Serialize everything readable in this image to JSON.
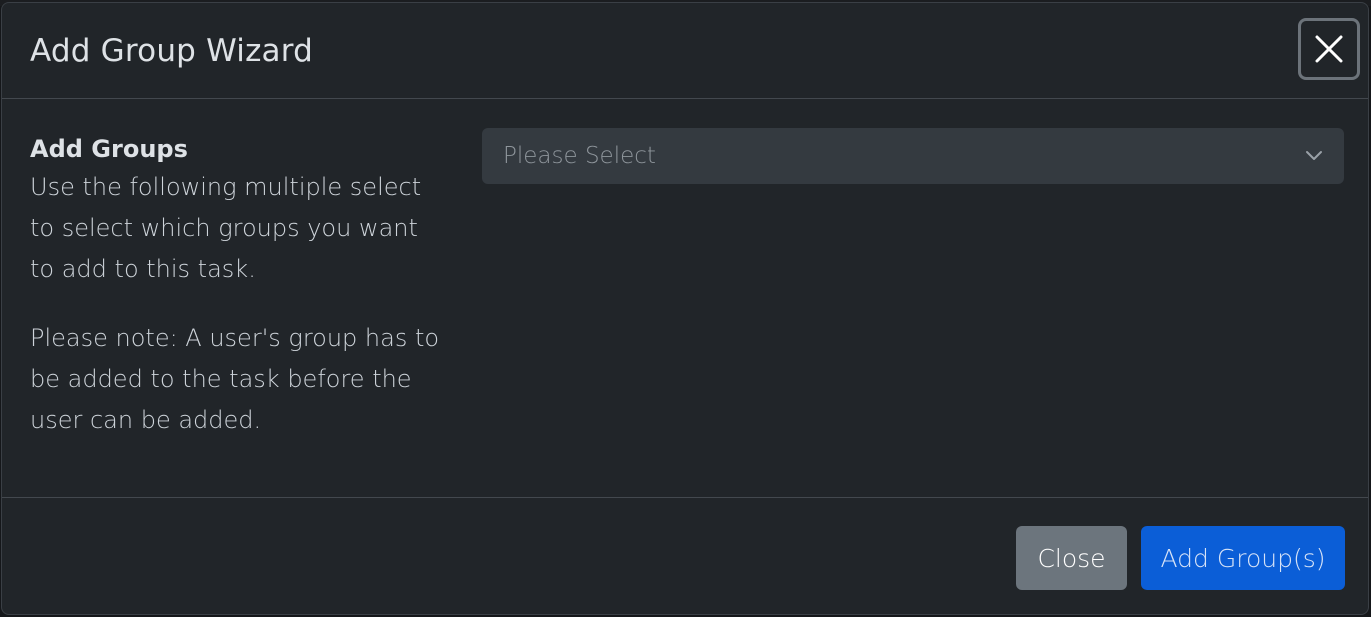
{
  "dialog": {
    "title": "Add Group Wizard",
    "close_icon": "close-icon"
  },
  "body": {
    "heading": "Add Groups",
    "description": "Use the following multiple select to select which groups you want to add to this task.",
    "note": "Please note: A user's group has to be added to the task before the user can be added.",
    "groups_select": {
      "placeholder": "Please Select",
      "icon": "chevron-down-icon"
    }
  },
  "footer": {
    "close_label": "Close",
    "add_label": "Add Group(s)"
  },
  "colors": {
    "modal_bg": "#212529",
    "select_bg": "#343a40",
    "secondary_button": "#6c757d",
    "primary_button": "#0b5ed7"
  }
}
